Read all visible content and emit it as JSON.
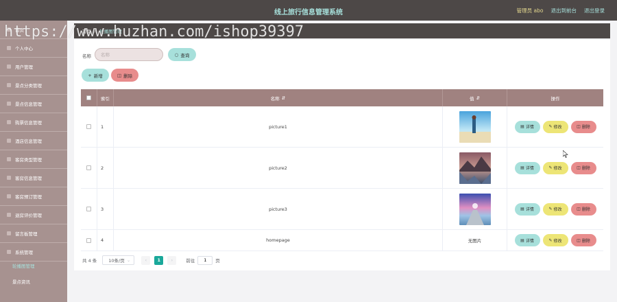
{
  "header": {
    "title": "线上旅行信息管理系统",
    "admin": "管理员 abo",
    "back_link": "退出到前台",
    "logout": "退出登录"
  },
  "sidebar": {
    "items": [
      {
        "label": "首页"
      },
      {
        "label": "个人中心"
      },
      {
        "label": "用户管理"
      },
      {
        "label": "景点分类管理"
      },
      {
        "label": "景点信息管理"
      },
      {
        "label": "购票信息管理"
      },
      {
        "label": "酒店信息管理"
      },
      {
        "label": "客房类型管理"
      },
      {
        "label": "客房信息管理"
      },
      {
        "label": "客房预订管理"
      },
      {
        "label": "退房评价管理"
      },
      {
        "label": "留言板管理"
      },
      {
        "label": "系统管理"
      }
    ],
    "sub_items": [
      {
        "label": "轮播图管理",
        "active": true
      },
      {
        "label": "景点资讯",
        "active": false
      }
    ]
  },
  "breadcrumb": {
    "home": "首页",
    "current": "轮播图管理"
  },
  "search": {
    "label": "名称",
    "placeholder": "名称",
    "button": "查询"
  },
  "toolbar": {
    "add": "新增",
    "delete": "删除"
  },
  "table": {
    "headers": {
      "index": "索引",
      "name": "名称",
      "image": "值",
      "actions": "操作"
    },
    "rows": [
      {
        "index": "1",
        "name": "picture1",
        "image": "beach"
      },
      {
        "index": "2",
        "name": "picture2",
        "image": "mountain-lake"
      },
      {
        "index": "3",
        "name": "picture3",
        "image": "pier-sunset"
      },
      {
        "index": "4",
        "name": "homepage",
        "image_text": "无图片"
      }
    ],
    "actions": {
      "detail": "详情",
      "edit": "修改",
      "remove": "删除"
    }
  },
  "pagination": {
    "total": "共 4 条",
    "page_size": "10条/页",
    "current_page": "1",
    "goto_label": "前往",
    "goto_value": "1",
    "goto_suffix": "页"
  },
  "watermark": "https://www.huzhan.com/ishop39397",
  "colors": {
    "header_bg": "#4d4847",
    "sidebar_bg": "#a79290",
    "accent_teal": "#a7e0db",
    "table_header_bg": "#a08280",
    "danger": "#e88c8c",
    "warning": "#ede576",
    "page_active": "#1aa89a"
  }
}
